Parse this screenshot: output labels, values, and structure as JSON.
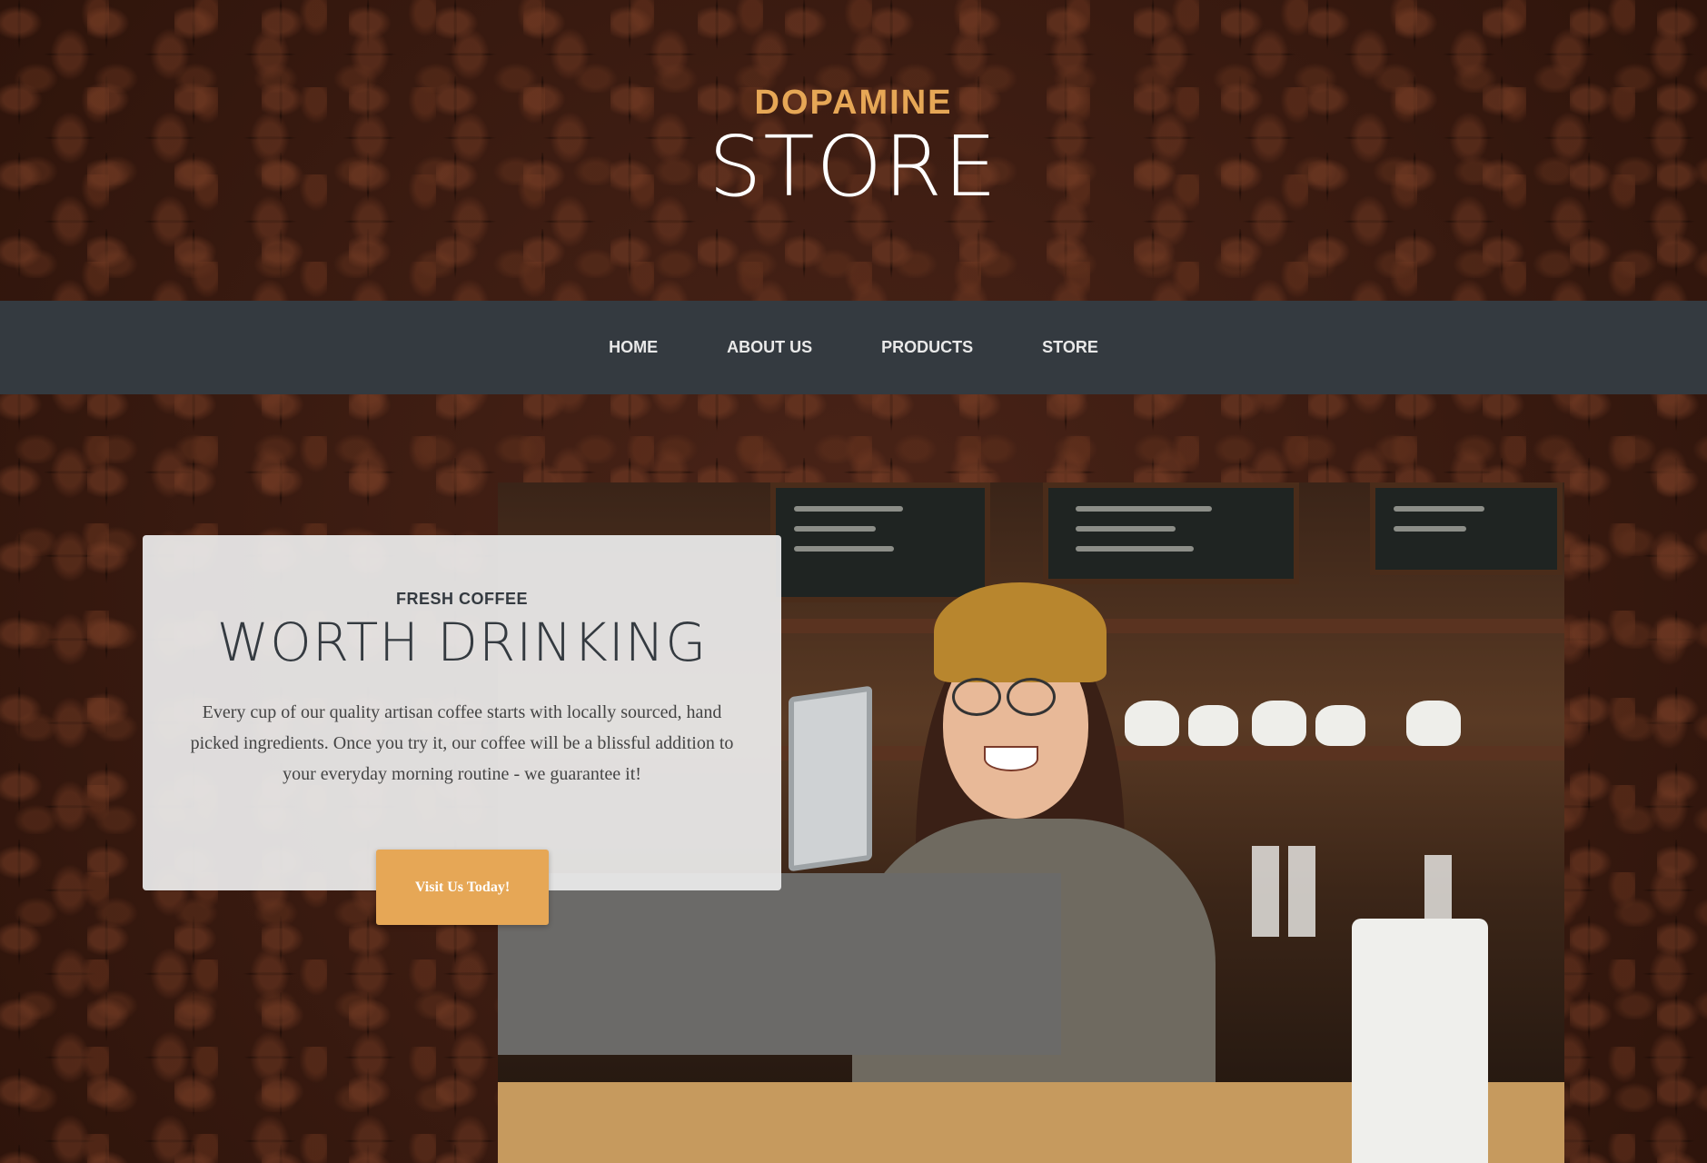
{
  "brand": {
    "top": "DOPAMINE",
    "bottom": "STORE"
  },
  "nav": {
    "items": [
      {
        "label": "HOME"
      },
      {
        "label": "ABOUT US"
      },
      {
        "label": "PRODUCTS"
      },
      {
        "label": "STORE"
      }
    ]
  },
  "hero": {
    "subheading": "FRESH COFFEE",
    "heading": "WORTH DRINKING",
    "body": "Every cup of our quality artisan coffee starts with locally sourced, hand picked ingredients. Once you try it, our coffee will be a blissful addition to your everyday morning routine - we guarantee it!",
    "cta_label": "Visit Us Today!"
  },
  "colors": {
    "accent": "#e6a756",
    "nav_bg": "#343a40",
    "card_bg": "#ececec"
  }
}
